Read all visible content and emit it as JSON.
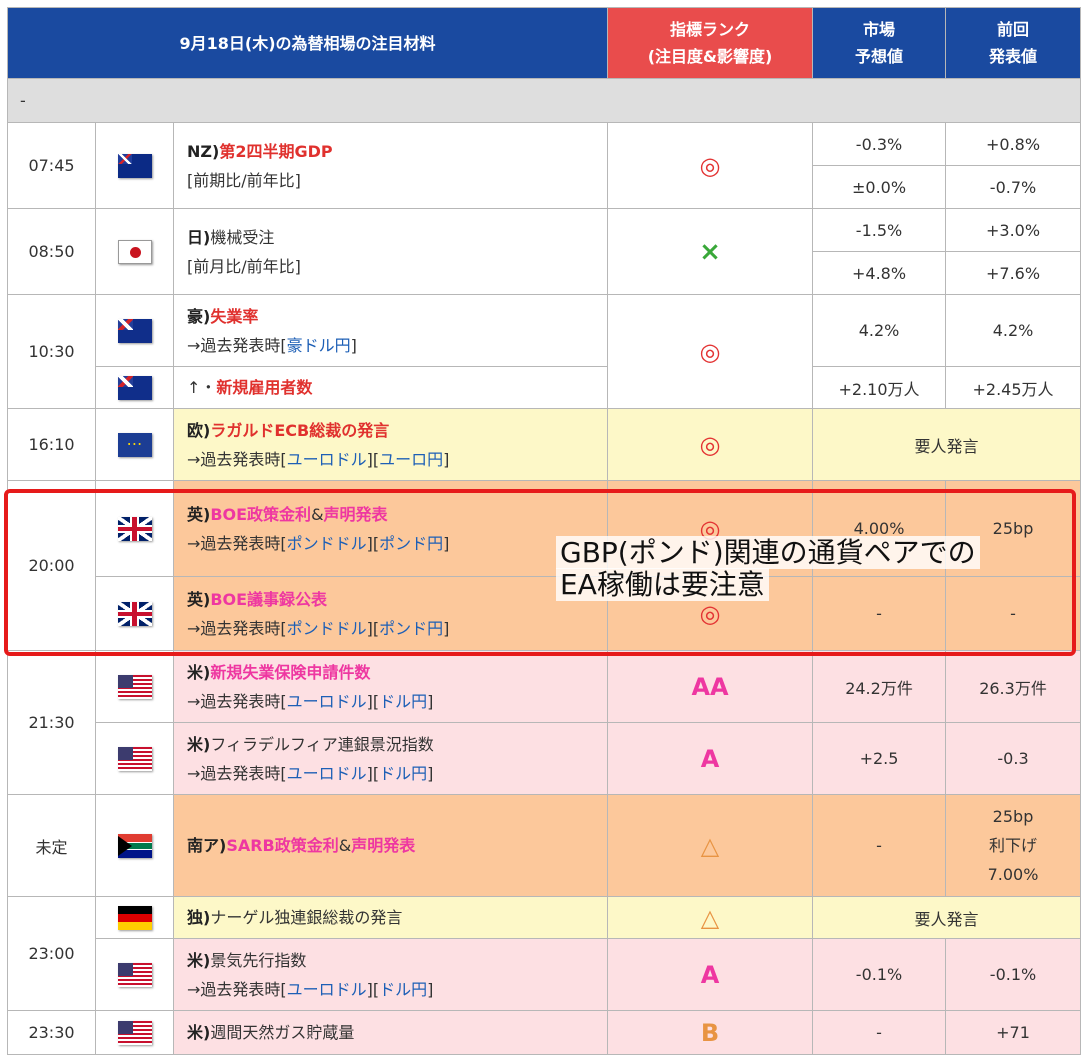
{
  "header": {
    "title": "9月18日(木)の為替相場の注目材料",
    "rank_line1": "指標ランク",
    "rank_line2": "(注目度&影響度)",
    "forecast_line1": "市場",
    "forecast_line2": "予想値",
    "previous_line1": "前回",
    "previous_line2": "発表値"
  },
  "separator": "-",
  "rows": [
    {
      "time": "07:45",
      "flag": "nz-flag-icon",
      "country": "NZ)",
      "event": "第2四半期GDP",
      "note": "[前期比/前年比]",
      "rank": "◎",
      "f1": "-0.3%",
      "p1": "+0.8%",
      "f2": "±0.0%",
      "p2": "-0.7%"
    },
    {
      "time": "08:50",
      "flag": "japan-flag-icon",
      "country": "日)",
      "event": "機械受注",
      "note": "[前月比/前年比]",
      "rank": "×",
      "f1": "-1.5%",
      "p1": "+3.0%",
      "f2": "+4.8%",
      "p2": "+7.6%"
    },
    {
      "time": "10:30",
      "flag": "australia-flag-icon",
      "country": "豪)",
      "event": "失業率",
      "note_prefix": "→過去発表時[",
      "note_link": "豪ドル円",
      "note_suffix": "]",
      "rank": "◎",
      "f1": "4.2%",
      "p1": "4.2%"
    },
    {
      "flag": "australia-flag-icon",
      "prefix": "↑・",
      "event": "新規雇用者数",
      "f1": "+2.10万人",
      "p1": "+2.45万人"
    },
    {
      "time": "16:10",
      "flag": "eu-flag-icon",
      "country": "欧)",
      "event": "ラガルドECB総裁の発言",
      "note_prefix": "→過去発表時[",
      "link1": "ユーロドル",
      "link2": "ユーロ円",
      "rank": "◎",
      "span_text": "要人発言"
    },
    {
      "time": "20:00",
      "flag": "uk-flag-icon",
      "country": "英)",
      "event": "BOE政策金利",
      "amp": "&",
      "event2": "声明発表",
      "note_prefix": "→過去発表時[",
      "link1": "ポンドドル",
      "link2": "ポンド円",
      "rank": "◎",
      "f1": "4.00%",
      "p1": "25bp"
    },
    {
      "flag": "uk-flag-icon",
      "country": "英)",
      "event": "BOE議事録公表",
      "note_prefix": "→過去発表時[",
      "link1": "ポンドドル",
      "link2": "ポンド円",
      "rank": "◎",
      "f1": "-",
      "p1": "-"
    },
    {
      "time": "21:30",
      "flag": "us-flag-icon",
      "country": "米)",
      "event": "新規失業保険申請件数",
      "note_prefix": "→過去発表時[",
      "link1": "ユーロドル",
      "link2": "ドル円",
      "rank": "AA",
      "f1": "24.2万件",
      "p1": "26.3万件"
    },
    {
      "flag": "us-flag-icon",
      "country": "米)",
      "event": "フィラデルフィア連銀景況指数",
      "note_prefix": "→過去発表時[",
      "link1": "ユーロドル",
      "link2": "ドル円",
      "rank": "A",
      "f1": "+2.5",
      "p1": "-0.3"
    },
    {
      "time": "未定",
      "flag": "south-africa-flag-icon",
      "country": "南ア)",
      "event": "SARB政策金利",
      "amp": "&",
      "event2": "声明発表",
      "rank": "△",
      "f1": "-",
      "p1a": "25bp",
      "p1b": "利下げ",
      "p1c": "7.00%"
    },
    {
      "time": "23:00",
      "flag": "germany-flag-icon",
      "country": "独)",
      "event": "ナーゲル独連銀総裁の発言",
      "rank": "△",
      "span_text": "要人発言"
    },
    {
      "flag": "us-flag-icon",
      "country": "米)",
      "event": "景気先行指数",
      "note_prefix": "→過去発表時[",
      "link1": "ユーロドル",
      "link2": "ドル円",
      "rank": "A",
      "f1": "-0.1%",
      "p1": "-0.1%"
    },
    {
      "time": "23:30",
      "flag": "us-flag-icon",
      "country": "米)",
      "event": "週間天然ガス貯蔵量",
      "rank": "B",
      "f1": "-",
      "p1": "+71"
    }
  ],
  "common": {
    "bracket_mid": "][",
    "bracket_end": "]"
  },
  "overlay": {
    "line1": "GBP(ポンド)関連の通貨ペアでの",
    "line2": "EA稼働は要注意"
  }
}
